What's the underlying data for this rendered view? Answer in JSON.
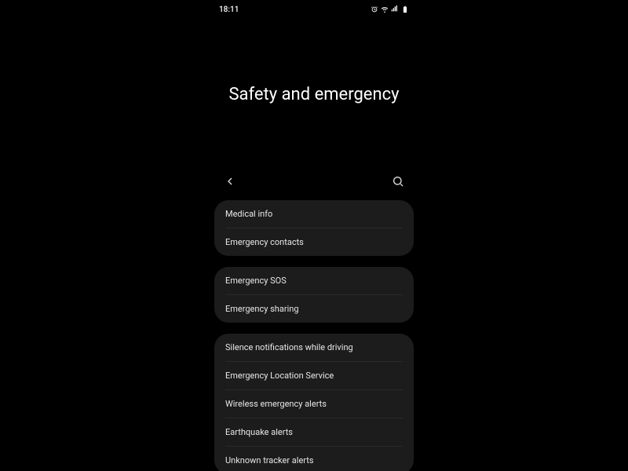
{
  "statusBar": {
    "time": "18:11"
  },
  "pageTitle": "Safety and emergency",
  "groups": [
    {
      "items": [
        {
          "label": "Medical info"
        },
        {
          "label": "Emergency contacts"
        }
      ]
    },
    {
      "items": [
        {
          "label": "Emergency SOS"
        },
        {
          "label": "Emergency sharing"
        }
      ]
    },
    {
      "items": [
        {
          "label": "Silence notifications while driving"
        },
        {
          "label": "Emergency Location Service"
        },
        {
          "label": "Wireless emergency alerts"
        },
        {
          "label": "Earthquake alerts"
        },
        {
          "label": "Unknown tracker alerts"
        }
      ]
    }
  ]
}
